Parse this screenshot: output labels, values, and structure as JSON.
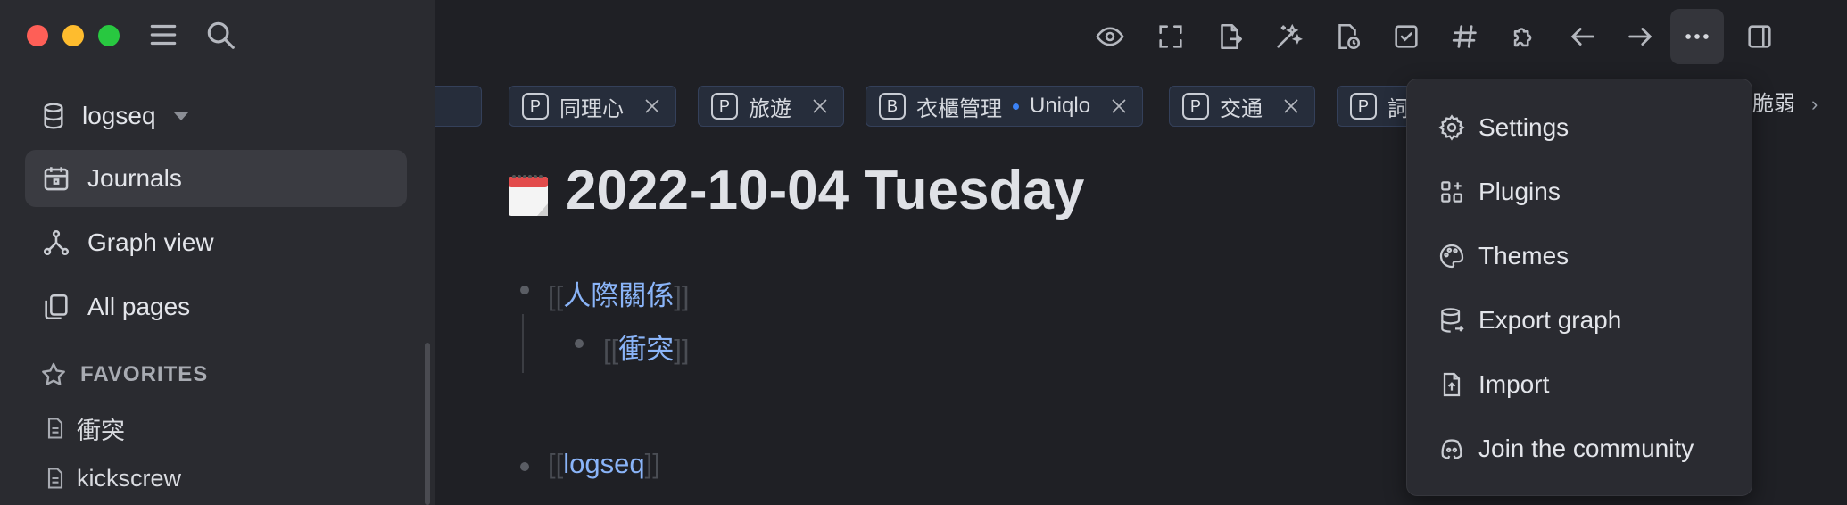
{
  "sidebar": {
    "repo": "logseq",
    "nav": [
      {
        "label": "Journals",
        "icon": "calendar-icon",
        "active": true
      },
      {
        "label": "Graph view",
        "icon": "graph-icon",
        "active": false
      },
      {
        "label": "All pages",
        "icon": "pages-icon",
        "active": false
      }
    ],
    "favorites_heading": "FAVORITES",
    "favorites": [
      "衝突",
      "kickscrew"
    ]
  },
  "tabs": [
    {
      "letter": "P",
      "label": "同理心"
    },
    {
      "letter": "P",
      "label": "旅遊"
    },
    {
      "letter": "B",
      "label": "衣櫃管理",
      "sub": "Uniqlo"
    },
    {
      "letter": "P",
      "label": "交通"
    },
    {
      "letter": "P",
      "label": "詞"
    }
  ],
  "tab_peek": "脆弱",
  "journal": {
    "title": "2022-10-04 Tuesday",
    "blocks": [
      {
        "link": "人際關係"
      },
      {
        "link": "衝突"
      },
      {
        "link": "logseq"
      }
    ]
  },
  "menu": {
    "items": [
      {
        "label": "Settings",
        "icon": "gear-icon"
      },
      {
        "label": "Plugins",
        "icon": "plugins-icon"
      },
      {
        "label": "Themes",
        "icon": "palette-icon"
      },
      {
        "label": "Export graph",
        "icon": "database-export-icon"
      },
      {
        "label": "Import",
        "icon": "file-import-icon"
      },
      {
        "label": "Join the community",
        "icon": "discord-icon"
      }
    ]
  },
  "colors": {
    "accent_link": "#8ab4f8",
    "tab_dot": "#3b82f6"
  }
}
